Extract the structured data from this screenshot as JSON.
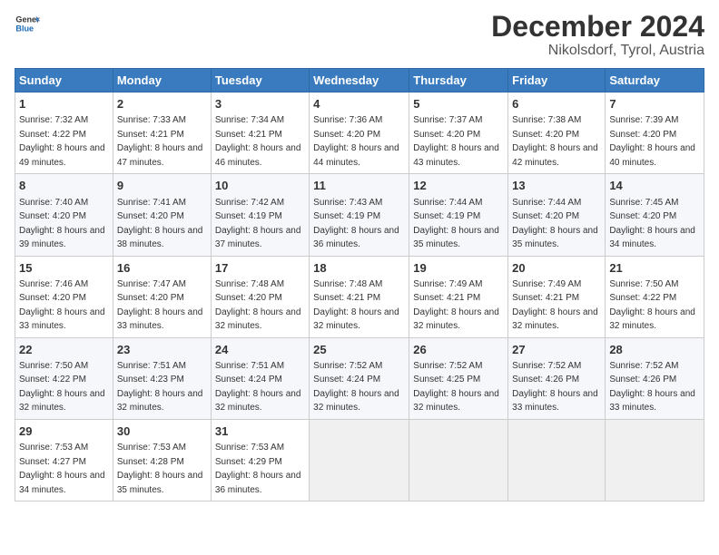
{
  "logo": {
    "text_general": "General",
    "text_blue": "Blue"
  },
  "title": "December 2024",
  "subtitle": "Nikolsdorf, Tyrol, Austria",
  "weekdays": [
    "Sunday",
    "Monday",
    "Tuesday",
    "Wednesday",
    "Thursday",
    "Friday",
    "Saturday"
  ],
  "weeks": [
    [
      {
        "day": "1",
        "sunrise": "Sunrise: 7:32 AM",
        "sunset": "Sunset: 4:22 PM",
        "daylight": "Daylight: 8 hours and 49 minutes."
      },
      {
        "day": "2",
        "sunrise": "Sunrise: 7:33 AM",
        "sunset": "Sunset: 4:21 PM",
        "daylight": "Daylight: 8 hours and 47 minutes."
      },
      {
        "day": "3",
        "sunrise": "Sunrise: 7:34 AM",
        "sunset": "Sunset: 4:21 PM",
        "daylight": "Daylight: 8 hours and 46 minutes."
      },
      {
        "day": "4",
        "sunrise": "Sunrise: 7:36 AM",
        "sunset": "Sunset: 4:20 PM",
        "daylight": "Daylight: 8 hours and 44 minutes."
      },
      {
        "day": "5",
        "sunrise": "Sunrise: 7:37 AM",
        "sunset": "Sunset: 4:20 PM",
        "daylight": "Daylight: 8 hours and 43 minutes."
      },
      {
        "day": "6",
        "sunrise": "Sunrise: 7:38 AM",
        "sunset": "Sunset: 4:20 PM",
        "daylight": "Daylight: 8 hours and 42 minutes."
      },
      {
        "day": "7",
        "sunrise": "Sunrise: 7:39 AM",
        "sunset": "Sunset: 4:20 PM",
        "daylight": "Daylight: 8 hours and 40 minutes."
      }
    ],
    [
      {
        "day": "8",
        "sunrise": "Sunrise: 7:40 AM",
        "sunset": "Sunset: 4:20 PM",
        "daylight": "Daylight: 8 hours and 39 minutes."
      },
      {
        "day": "9",
        "sunrise": "Sunrise: 7:41 AM",
        "sunset": "Sunset: 4:20 PM",
        "daylight": "Daylight: 8 hours and 38 minutes."
      },
      {
        "day": "10",
        "sunrise": "Sunrise: 7:42 AM",
        "sunset": "Sunset: 4:19 PM",
        "daylight": "Daylight: 8 hours and 37 minutes."
      },
      {
        "day": "11",
        "sunrise": "Sunrise: 7:43 AM",
        "sunset": "Sunset: 4:19 PM",
        "daylight": "Daylight: 8 hours and 36 minutes."
      },
      {
        "day": "12",
        "sunrise": "Sunrise: 7:44 AM",
        "sunset": "Sunset: 4:19 PM",
        "daylight": "Daylight: 8 hours and 35 minutes."
      },
      {
        "day": "13",
        "sunrise": "Sunrise: 7:44 AM",
        "sunset": "Sunset: 4:20 PM",
        "daylight": "Daylight: 8 hours and 35 minutes."
      },
      {
        "day": "14",
        "sunrise": "Sunrise: 7:45 AM",
        "sunset": "Sunset: 4:20 PM",
        "daylight": "Daylight: 8 hours and 34 minutes."
      }
    ],
    [
      {
        "day": "15",
        "sunrise": "Sunrise: 7:46 AM",
        "sunset": "Sunset: 4:20 PM",
        "daylight": "Daylight: 8 hours and 33 minutes."
      },
      {
        "day": "16",
        "sunrise": "Sunrise: 7:47 AM",
        "sunset": "Sunset: 4:20 PM",
        "daylight": "Daylight: 8 hours and 33 minutes."
      },
      {
        "day": "17",
        "sunrise": "Sunrise: 7:48 AM",
        "sunset": "Sunset: 4:20 PM",
        "daylight": "Daylight: 8 hours and 32 minutes."
      },
      {
        "day": "18",
        "sunrise": "Sunrise: 7:48 AM",
        "sunset": "Sunset: 4:21 PM",
        "daylight": "Daylight: 8 hours and 32 minutes."
      },
      {
        "day": "19",
        "sunrise": "Sunrise: 7:49 AM",
        "sunset": "Sunset: 4:21 PM",
        "daylight": "Daylight: 8 hours and 32 minutes."
      },
      {
        "day": "20",
        "sunrise": "Sunrise: 7:49 AM",
        "sunset": "Sunset: 4:21 PM",
        "daylight": "Daylight: 8 hours and 32 minutes."
      },
      {
        "day": "21",
        "sunrise": "Sunrise: 7:50 AM",
        "sunset": "Sunset: 4:22 PM",
        "daylight": "Daylight: 8 hours and 32 minutes."
      }
    ],
    [
      {
        "day": "22",
        "sunrise": "Sunrise: 7:50 AM",
        "sunset": "Sunset: 4:22 PM",
        "daylight": "Daylight: 8 hours and 32 minutes."
      },
      {
        "day": "23",
        "sunrise": "Sunrise: 7:51 AM",
        "sunset": "Sunset: 4:23 PM",
        "daylight": "Daylight: 8 hours and 32 minutes."
      },
      {
        "day": "24",
        "sunrise": "Sunrise: 7:51 AM",
        "sunset": "Sunset: 4:24 PM",
        "daylight": "Daylight: 8 hours and 32 minutes."
      },
      {
        "day": "25",
        "sunrise": "Sunrise: 7:52 AM",
        "sunset": "Sunset: 4:24 PM",
        "daylight": "Daylight: 8 hours and 32 minutes."
      },
      {
        "day": "26",
        "sunrise": "Sunrise: 7:52 AM",
        "sunset": "Sunset: 4:25 PM",
        "daylight": "Daylight: 8 hours and 32 minutes."
      },
      {
        "day": "27",
        "sunrise": "Sunrise: 7:52 AM",
        "sunset": "Sunset: 4:26 PM",
        "daylight": "Daylight: 8 hours and 33 minutes."
      },
      {
        "day": "28",
        "sunrise": "Sunrise: 7:52 AM",
        "sunset": "Sunset: 4:26 PM",
        "daylight": "Daylight: 8 hours and 33 minutes."
      }
    ],
    [
      {
        "day": "29",
        "sunrise": "Sunrise: 7:53 AM",
        "sunset": "Sunset: 4:27 PM",
        "daylight": "Daylight: 8 hours and 34 minutes."
      },
      {
        "day": "30",
        "sunrise": "Sunrise: 7:53 AM",
        "sunset": "Sunset: 4:28 PM",
        "daylight": "Daylight: 8 hours and 35 minutes."
      },
      {
        "day": "31",
        "sunrise": "Sunrise: 7:53 AM",
        "sunset": "Sunset: 4:29 PM",
        "daylight": "Daylight: 8 hours and 36 minutes."
      },
      null,
      null,
      null,
      null
    ]
  ]
}
